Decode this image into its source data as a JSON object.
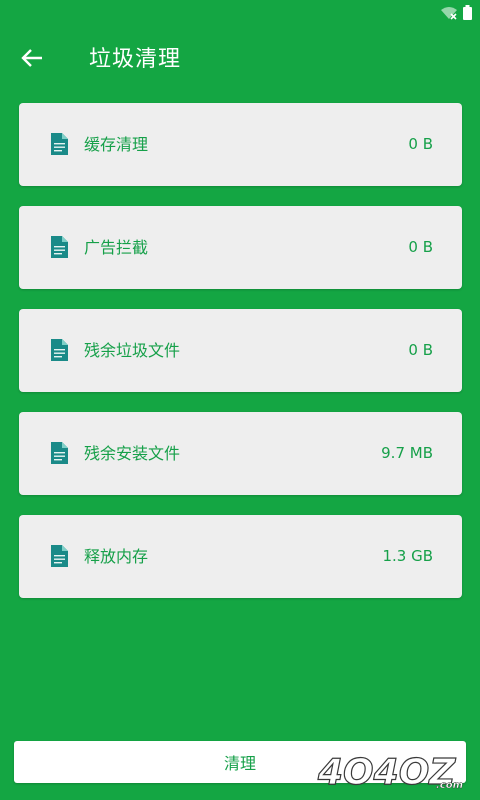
{
  "toolbar": {
    "title": "垃圾清理",
    "back_icon": "arrow-back-icon"
  },
  "status_bar": {
    "icons": [
      "wifi-off-icon",
      "battery-icon"
    ]
  },
  "colors": {
    "background": "#14a643",
    "card": "#eeeeee",
    "text_accent": "#16a049",
    "icon": "#1a8a88"
  },
  "items": [
    {
      "label": "缓存清理",
      "value": "0 B",
      "icon": "document-icon"
    },
    {
      "label": "广告拦截",
      "value": "0 B",
      "icon": "document-icon"
    },
    {
      "label": "残余垃圾文件",
      "value": "0 B",
      "icon": "document-icon"
    },
    {
      "label": "残余安装文件",
      "value": "9.7 MB",
      "icon": "document-icon"
    },
    {
      "label": "释放内存",
      "value": "1.3 GB",
      "icon": "document-icon"
    }
  ],
  "actions": {
    "clean_label": "清理"
  },
  "watermark": {
    "text": "4O4OZ.com"
  }
}
